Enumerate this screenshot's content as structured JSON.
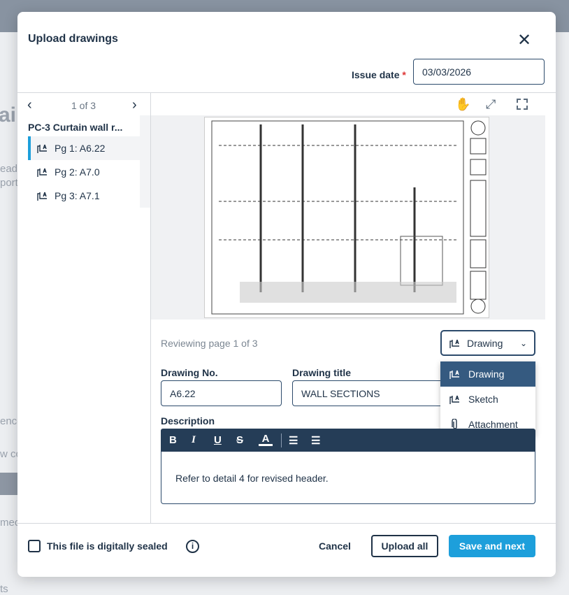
{
  "background": {
    "fragments": [
      "ain",
      "eade",
      "port",
      "ence",
      "w co",
      "mec",
      "ts"
    ]
  },
  "modal": {
    "title": "Upload drawings",
    "issue_date_label": "Issue date",
    "required_mark": "*",
    "issue_date_value": "03/03/2026"
  },
  "sidebar": {
    "pager": "1 of 3",
    "file_name": "PC-3 Curtain wall r...",
    "items": [
      {
        "label": "Pg 1: A6.22"
      },
      {
        "label": "Pg 2: A7.0"
      },
      {
        "label": "Pg 3: A7.1"
      }
    ]
  },
  "viewer": {
    "tools": [
      "hand-icon",
      "expand-icon",
      "zoom-select-icon"
    ]
  },
  "review": {
    "status": "Reviewing page 1 of 3",
    "type_selected": "Drawing",
    "type_options": [
      "Drawing",
      "Sketch",
      "Attachment"
    ]
  },
  "form": {
    "drawing_no_label": "Drawing No.",
    "drawing_no_value": "A6.22",
    "drawing_title_label": "Drawing title",
    "drawing_title_value": "WALL SECTIONS",
    "description_label": "Description",
    "description_value": "Refer to detail 4 for revised header.",
    "toolbar": {
      "bold": "B",
      "italic": "I",
      "underline": "U",
      "strike": "S",
      "color": "A"
    }
  },
  "footer": {
    "sealed_label": "This file is digitally sealed",
    "cancel": "Cancel",
    "upload_all": "Upload all",
    "save_next": "Save and next"
  },
  "colors": {
    "accent": "#1d9fdb",
    "dark": "#253d57",
    "selected_menu": "#355a80"
  }
}
